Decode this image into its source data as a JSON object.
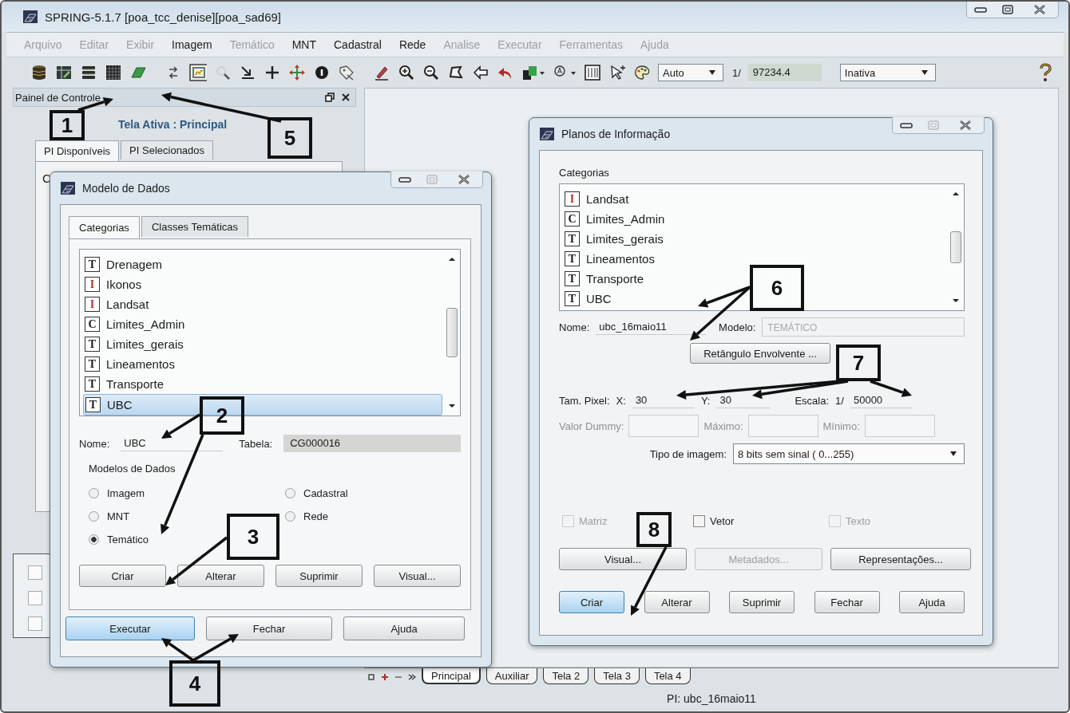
{
  "window": {
    "title": "SPRING-5.1.7 [poa_tcc_denise][poa_sad69]"
  },
  "menu": [
    {
      "label": "Arquivo",
      "disabled": true
    },
    {
      "label": "Editar",
      "disabled": true
    },
    {
      "label": "Exibir",
      "disabled": true
    },
    {
      "label": "Imagem",
      "disabled": false
    },
    {
      "label": "Temático",
      "disabled": true
    },
    {
      "label": "MNT",
      "disabled": false
    },
    {
      "label": "Cadastral",
      "disabled": false
    },
    {
      "label": "Rede",
      "disabled": false
    },
    {
      "label": "Analise",
      "disabled": true
    },
    {
      "label": "Executar",
      "disabled": true
    },
    {
      "label": "Ferramentas",
      "disabled": true
    },
    {
      "label": "Ajuda",
      "disabled": true
    }
  ],
  "toolbar": {
    "scale_mode": "Auto",
    "scale_prefix": "1/",
    "scale_value": "97234.4",
    "edit_mode": "Inativa"
  },
  "control_panel": {
    "title": "Painel de Controle",
    "active_screen": "Tela Ativa : Principal",
    "tabs": [
      {
        "label": "PI Disponíveis",
        "selected": true
      },
      {
        "label": "PI Selecionados",
        "selected": false
      }
    ],
    "list_fragment": "C",
    "options": [
      {
        "checked": false
      },
      {
        "checked": false
      },
      {
        "checked": false
      }
    ]
  },
  "screen_tabs": [
    {
      "label": "Principal",
      "selected": true
    },
    {
      "label": "Auxiliar",
      "selected": false
    },
    {
      "label": "Tela 2",
      "selected": false
    },
    {
      "label": "Tela 3",
      "selected": false
    },
    {
      "label": "Tela 4",
      "selected": false
    }
  ],
  "status_bar": {
    "text": "PI: ubc_16maio11"
  },
  "model_dialog": {
    "title": "Modelo de Dados",
    "tabs": [
      {
        "label": "Categorias",
        "selected": true
      },
      {
        "label": "Classes Temáticas",
        "selected": false
      }
    ],
    "categories": [
      {
        "badge": "T",
        "color": "#1a1a1a",
        "label": "Drenagem",
        "selected": false
      },
      {
        "badge": "I",
        "color": "#b8322a",
        "label": "Ikonos",
        "selected": false
      },
      {
        "badge": "I",
        "color": "#b8322a",
        "label": "Landsat",
        "selected": false
      },
      {
        "badge": "C",
        "color": "#1a1a1a",
        "label": "Limites_Admin",
        "selected": false
      },
      {
        "badge": "T",
        "color": "#1a1a1a",
        "label": "Limites_gerais",
        "selected": false
      },
      {
        "badge": "T",
        "color": "#1a1a1a",
        "label": "Lineamentos",
        "selected": false
      },
      {
        "badge": "T",
        "color": "#1a1a1a",
        "label": "Transporte",
        "selected": false
      },
      {
        "badge": "T",
        "color": "#1a1a1a",
        "label": "UBC",
        "selected": true
      }
    ],
    "name_label": "Nome:",
    "name_value": "UBC",
    "table_label": "Tabela:",
    "table_value": "CG000016",
    "models_label": "Modelos de Dados",
    "models": [
      {
        "label": "Imagem",
        "selected": false
      },
      {
        "label": "Cadastral",
        "selected": false
      },
      {
        "label": "MNT",
        "selected": false
      },
      {
        "label": "Rede",
        "selected": false
      },
      {
        "label": "Temático",
        "selected": true
      }
    ],
    "actions": [
      {
        "label": "Criar"
      },
      {
        "label": "Alterar"
      },
      {
        "label": "Suprimir"
      },
      {
        "label": "Visual..."
      }
    ],
    "footer_buttons": [
      {
        "label": "Executar",
        "focused": true
      },
      {
        "label": "Fechar",
        "focused": false
      },
      {
        "label": "Ajuda",
        "focused": false
      }
    ]
  },
  "info_plane_dialog": {
    "title": "Planos de Informação",
    "categories_label": "Categorias",
    "categories": [
      {
        "badge": "I",
        "color": "#b8322a",
        "label": "Landsat",
        "selected": false
      },
      {
        "badge": "C",
        "color": "#1a1a1a",
        "label": "Limites_Admin",
        "selected": false
      },
      {
        "badge": "T",
        "color": "#1a1a1a",
        "label": "Limites_gerais",
        "selected": false
      },
      {
        "badge": "T",
        "color": "#1a1a1a",
        "label": "Lineamentos",
        "selected": false
      },
      {
        "badge": "T",
        "color": "#1a1a1a",
        "label": "Transporte",
        "selected": false
      },
      {
        "badge": "T",
        "color": "#1a1a1a",
        "label": "UBC",
        "selected": false
      }
    ],
    "name_label": "Nome:",
    "name_value": "ubc_16maio11",
    "model_label": "Modelo:",
    "model_value": "TEMÁTICO",
    "bbox_button": "Retângulo Envolvente ...",
    "pixel_label": "Tam. Pixel:",
    "x_label": "X:",
    "x_value": "30",
    "y_label": "Y:",
    "y_value": "30",
    "scale_label": "Escala:",
    "scale_prefix": "1/",
    "scale_value": "50000",
    "range_fields": [
      {
        "label": "Valor Dummy:"
      },
      {
        "label": "Máximo:"
      },
      {
        "label": "Mínimo:"
      }
    ],
    "image_type_label": "Tipo de imagem:",
    "image_type_value": "8 bits sem sinal ( 0...255)",
    "checkboxes": [
      {
        "label": "Matriz",
        "checked": false,
        "disabled": true
      },
      {
        "label": "Vetor",
        "checked": false,
        "disabled": false
      },
      {
        "label": "Texto",
        "checked": false,
        "disabled": true
      }
    ],
    "mid_buttons": [
      {
        "label": "Visual...",
        "disabled": false
      },
      {
        "label": "Metadados...",
        "disabled": true
      },
      {
        "label": "Representações...",
        "disabled": false
      }
    ],
    "footer_buttons": [
      {
        "label": "Criar",
        "focused": true
      },
      {
        "label": "Alterar",
        "focused": false
      },
      {
        "label": "Suprimir",
        "focused": false
      },
      {
        "label": "Fechar",
        "focused": false
      },
      {
        "label": "Ajuda",
        "focused": false
      }
    ]
  },
  "annotations": [
    {
      "label": "1"
    },
    {
      "label": "2"
    },
    {
      "label": "3"
    },
    {
      "label": "4"
    },
    {
      "label": "5"
    },
    {
      "label": "6"
    },
    {
      "label": "7"
    },
    {
      "label": "8"
    }
  ]
}
